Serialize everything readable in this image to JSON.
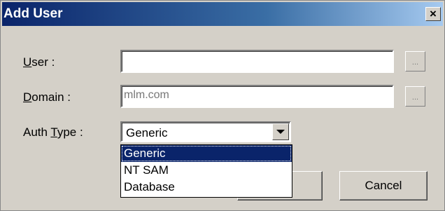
{
  "window": {
    "title": "Add User",
    "close_symbol": "×"
  },
  "form": {
    "user": {
      "label_accel": "U",
      "label_rest": "ser :",
      "value": ""
    },
    "domain": {
      "label_accel": "D",
      "label_rest": "omain :",
      "value": "mlm.com"
    },
    "auth_type": {
      "label_pre": "Auth ",
      "label_accel": "T",
      "label_rest": "ype :",
      "selected": "Generic",
      "options": [
        "Generic",
        "NT SAM",
        "Database"
      ]
    },
    "browse_label": "..."
  },
  "buttons": {
    "ok_label": "",
    "cancel_label": "Cancel"
  }
}
